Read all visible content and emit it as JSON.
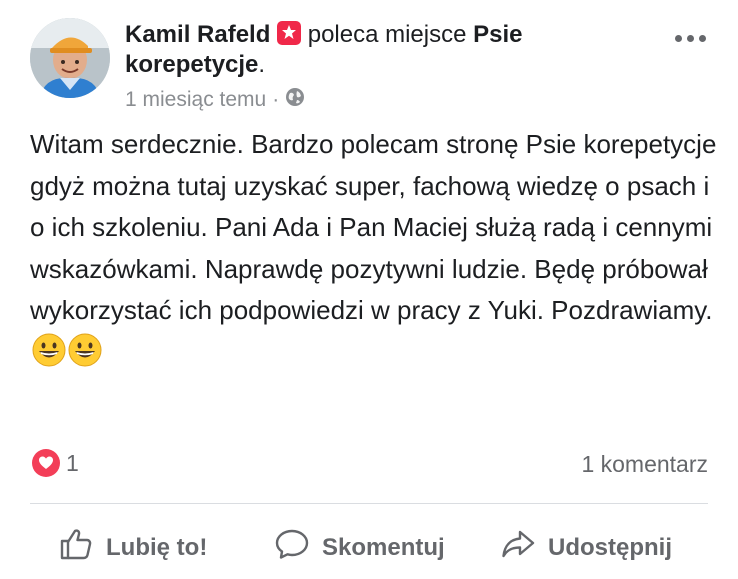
{
  "post": {
    "author_name": "Kamil Rafeld",
    "action_text": " poleca miejsce ",
    "page_name": "Psie korepetycje",
    "page_name_suffix": ".",
    "timestamp": "1 miesiąc temu",
    "separator": "·",
    "privacy_icon": "globe-icon",
    "more_icon": "more-options-icon",
    "body_text": "Witam serdecznie. Bardzo polecam stronę Psie korepetycje gdyż można tutaj uzyskać super, fachową wiedzę o psach i o ich szkoleniu. Pani Ada i Pan Maciej służą radą i cennymi wskazówkami. Naprawdę pozytywni ludzie. Będę próbował wykorzystać ich podpowiedzi w pracy z Yuki. Pozdrawiamy.",
    "emojis": [
      "grinning-face-emoji",
      "grinning-face-emoji"
    ]
  },
  "reactions": {
    "icon": "love-reaction-icon",
    "count": "1",
    "comments_label": "1 komentarz"
  },
  "actions": {
    "like_label": "Lubię to!",
    "comment_label": "Skomentuj",
    "share_label": "Udostępnij"
  },
  "colors": {
    "text": "#1c1e21",
    "secondary": "#65676b",
    "muted": "#8a8d91",
    "recommend_badge": "#f02849",
    "love": "#f33e58",
    "divider": "#dadde1"
  }
}
